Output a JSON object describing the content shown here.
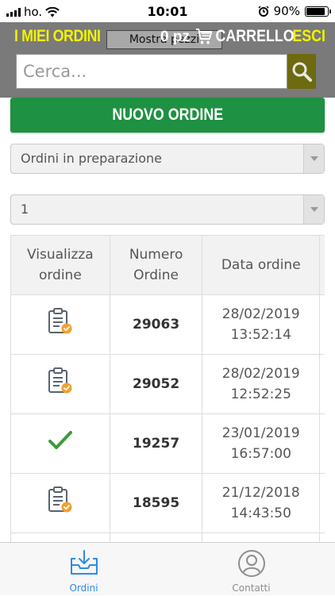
{
  "status_bar": {
    "carrier": "ho.",
    "time": "10:01",
    "battery": "90%",
    "battery_level": 0.9
  },
  "header": {
    "title": "I MIEI ORDINI",
    "mostra_label": "Mostra pezzi",
    "cart_count": "0 pz",
    "cart_label": "CARRELLO",
    "logout_label": "ESCI"
  },
  "search": {
    "placeholder": "Cerca..."
  },
  "new_order_button": "NUOVO ORDINE",
  "filter_select": {
    "selected": "Ordini in preparazione"
  },
  "page_select": {
    "selected": "1"
  },
  "orders_table": {
    "headers": {
      "view": [
        "Visualizza",
        "ordine"
      ],
      "number": [
        "Numero",
        "Ordine"
      ],
      "date": "Data ordine"
    },
    "rows": [
      {
        "icon": "clipboard-check-icon",
        "number": "29063",
        "date": "28/02/2019",
        "time": "13:52:14"
      },
      {
        "icon": "clipboard-check-icon",
        "number": "29052",
        "date": "28/02/2019",
        "time": "12:52:25"
      },
      {
        "icon": "green-checkmark-icon",
        "number": "19257",
        "date": "23/01/2019",
        "time": "16:57:00"
      },
      {
        "icon": "clipboard-check-icon",
        "number": "18595",
        "date": "21/12/2018",
        "time": "14:43:50"
      }
    ]
  },
  "tabbar": {
    "tabs": [
      {
        "label": "Ordini",
        "icon": "inbox-tray-icon",
        "active": true
      },
      {
        "label": "Contatti",
        "icon": "contact-person-icon",
        "active": false
      }
    ]
  },
  "colors": {
    "accent_yellow": "#f2f200",
    "header_gray": "#7a7a7a",
    "button_green": "#1e9142",
    "tab_active": "#2e8ae6",
    "check_green": "#3a9b3a",
    "badge_orange": "#f0a030"
  }
}
